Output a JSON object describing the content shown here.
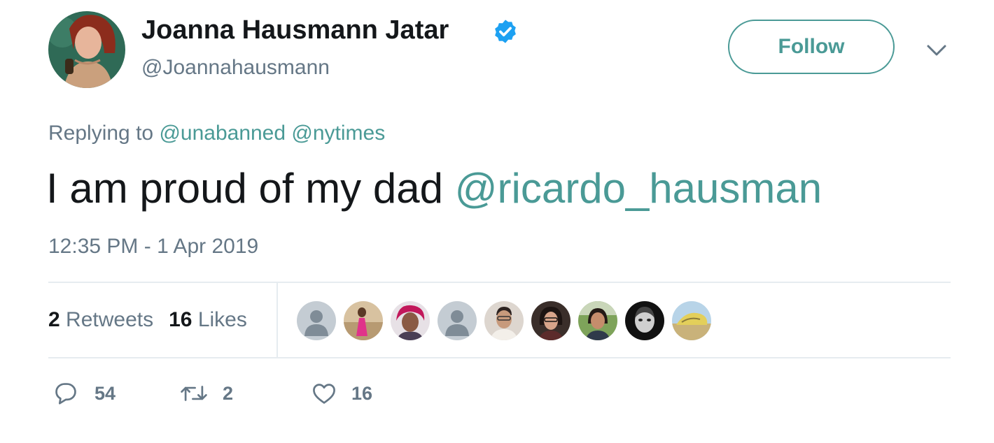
{
  "tweet": {
    "display_name": "Joanna Hausmann Jatar",
    "handle": "@Joannahausmann",
    "follow_label": "Follow",
    "replying_prefix": "Replying to",
    "replying_to": [
      "@unabanned",
      "@nytimes"
    ],
    "text": "I am proud of my dad",
    "text_mention": "@ricardo_hausman",
    "timestamp": "12:35 PM - 1 Apr 2019",
    "stats": {
      "retweets_count": "2",
      "retweets_label": "Retweets",
      "likes_count": "16",
      "likes_label": "Likes"
    },
    "actions": {
      "reply_count": "54",
      "retweet_count": "2",
      "like_count": "16"
    }
  },
  "icons": {
    "verified": "verified-badge-icon",
    "caret": "chevron-down-icon",
    "reply": "reply-bubble-icon",
    "retweet": "retweet-arrows-icon",
    "like": "heart-icon"
  },
  "colors": {
    "accent": "#4a9a96",
    "verified": "#1da1f2",
    "muted": "#657786",
    "text": "#14171a",
    "divider": "#e6ecf0"
  }
}
